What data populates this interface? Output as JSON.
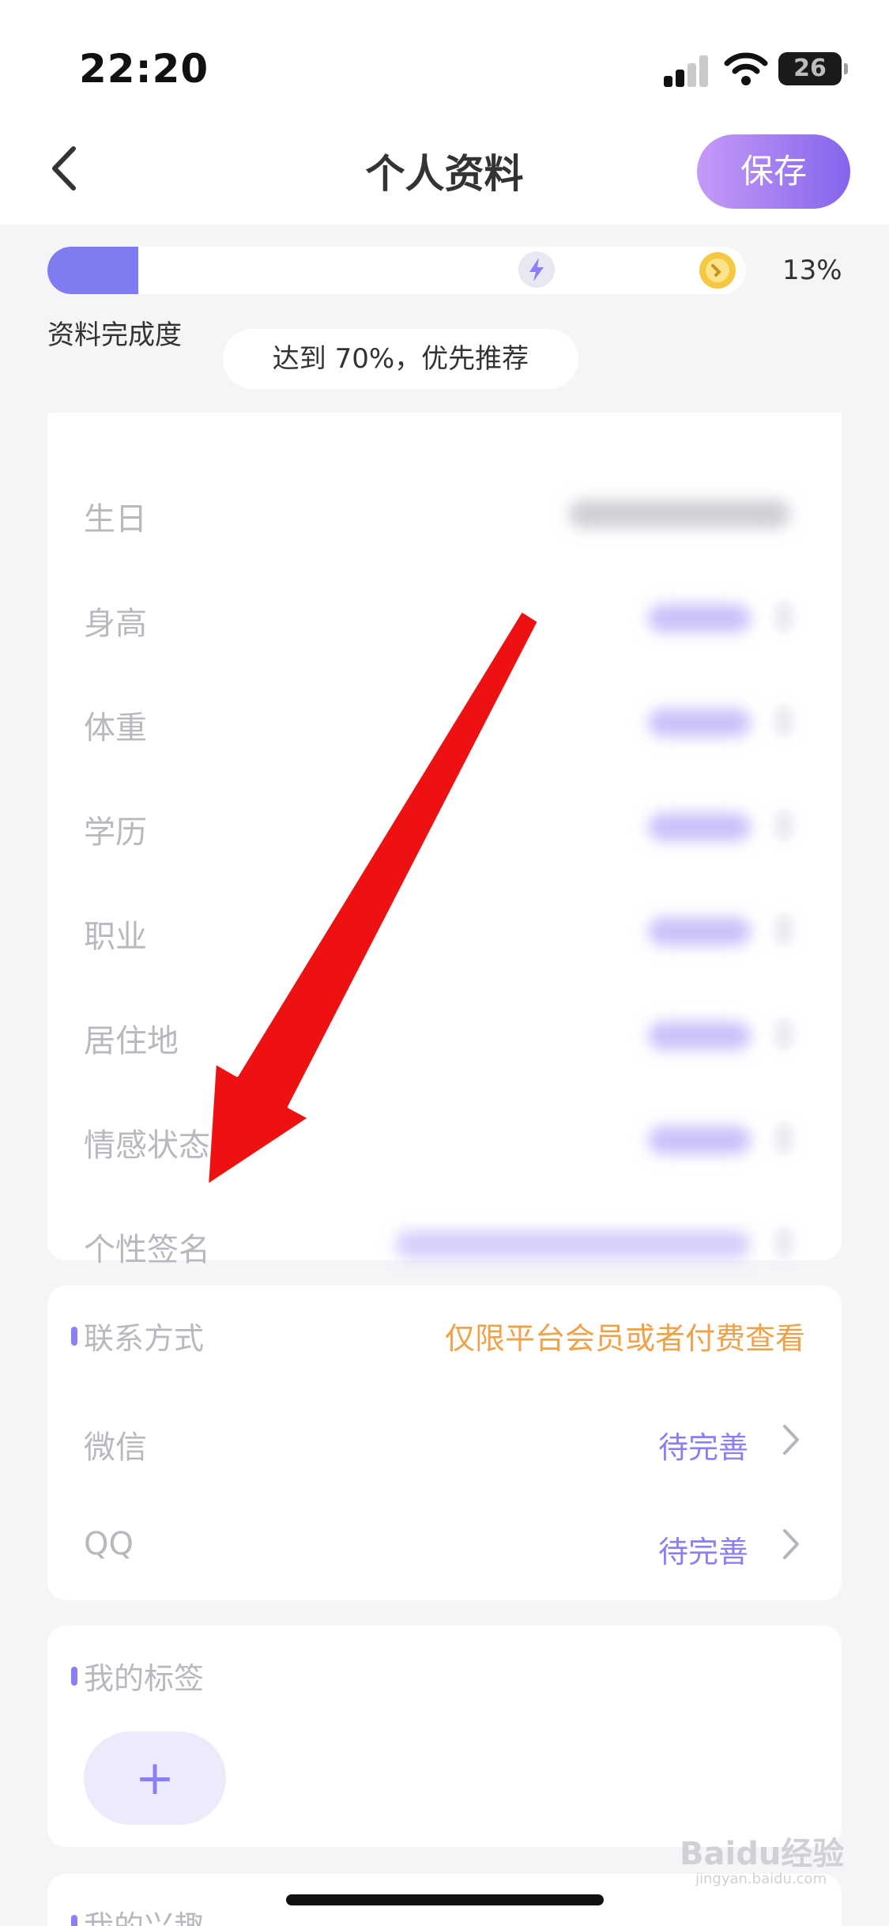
{
  "status_bar": {
    "time": "22:20",
    "battery": "26"
  },
  "header": {
    "title": "个人资料",
    "save_label": "保存"
  },
  "progress": {
    "percent_fraction": 0.13,
    "percent_label": "13%",
    "label": "资料完成度",
    "tip": "达到 70%，优先推荐"
  },
  "profile_fields": [
    {
      "label": "生日"
    },
    {
      "label": "身高"
    },
    {
      "label": "体重"
    },
    {
      "label": "学历"
    },
    {
      "label": "职业"
    },
    {
      "label": "居住地"
    },
    {
      "label": "情感状态"
    },
    {
      "label": "个性签名"
    }
  ],
  "contact": {
    "title": "联系方式",
    "note": "仅限平台会员或者付费查看",
    "items": [
      {
        "label": "微信",
        "value": "待完善"
      },
      {
        "label": "QQ",
        "value": "待完善"
      }
    ]
  },
  "tags": {
    "title": "我的标签",
    "add_label": "+"
  },
  "interests": {
    "title": "我的兴趣"
  },
  "watermark": {
    "brand": "Baidu经验",
    "url": "jingyan.baidu.com"
  },
  "colors": {
    "accent": "#8a7ff5",
    "warning": "#f0a24a",
    "arrow": "#ee1111"
  }
}
